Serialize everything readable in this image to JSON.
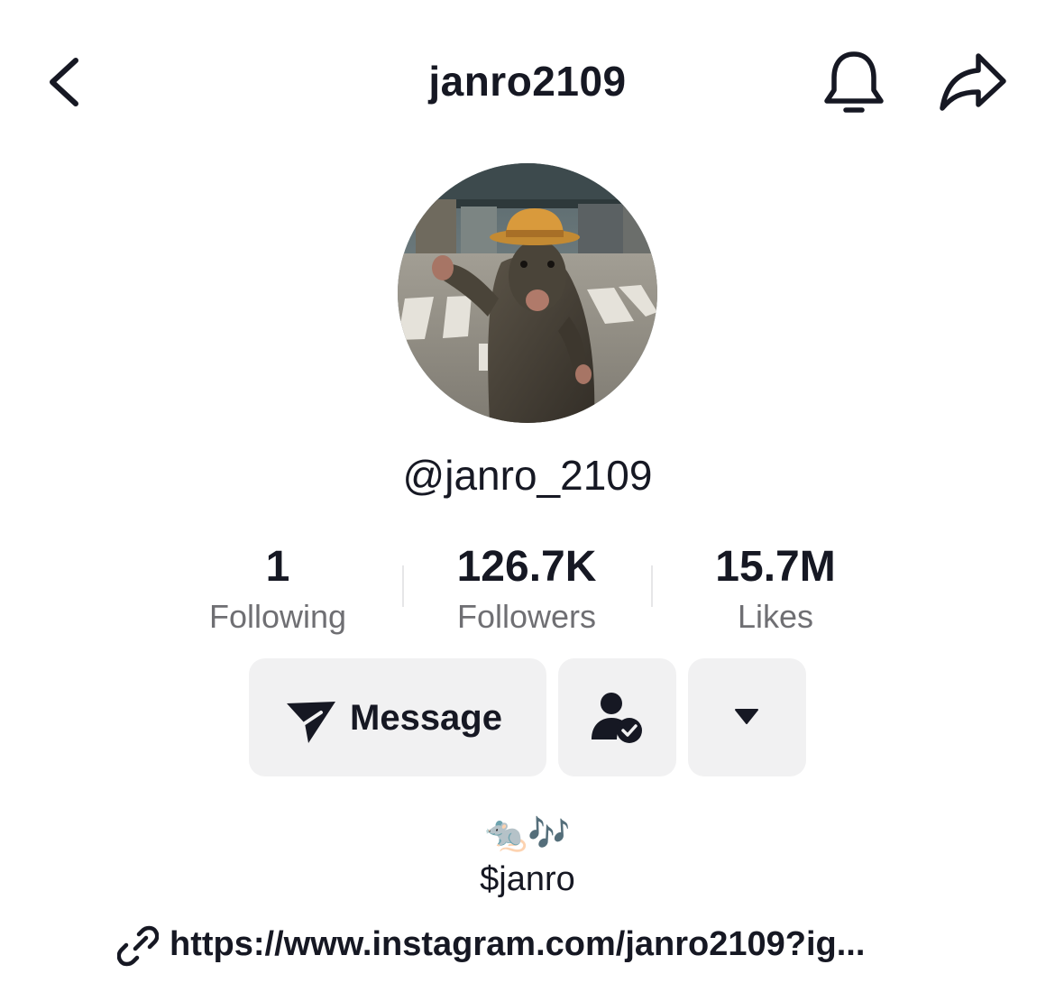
{
  "header": {
    "title": "janro2109",
    "back_icon": "chevron-left-icon",
    "bell_icon": "bell-icon",
    "share_icon": "share-arrow-icon"
  },
  "profile": {
    "handle": "@janro_2109",
    "avatar_description": "rat-in-straw-hat-avatar"
  },
  "stats": [
    {
      "value": "1",
      "label": "Following"
    },
    {
      "value": "126.7K",
      "label": "Followers"
    },
    {
      "value": "15.7M",
      "label": "Likes"
    }
  ],
  "actions": {
    "message_label": "Message",
    "message_icon": "send-icon",
    "friend_icon": "friend-check-icon",
    "more_icon": "caret-down-icon"
  },
  "bio": {
    "emoji_line": "🐀🎶",
    "text": "$janro",
    "link": "https://www.instagram.com/janro2109?ig..."
  },
  "colors": {
    "text": "#161823",
    "secondary_text": "#6f6f73",
    "button_bg": "#f1f1f2"
  }
}
